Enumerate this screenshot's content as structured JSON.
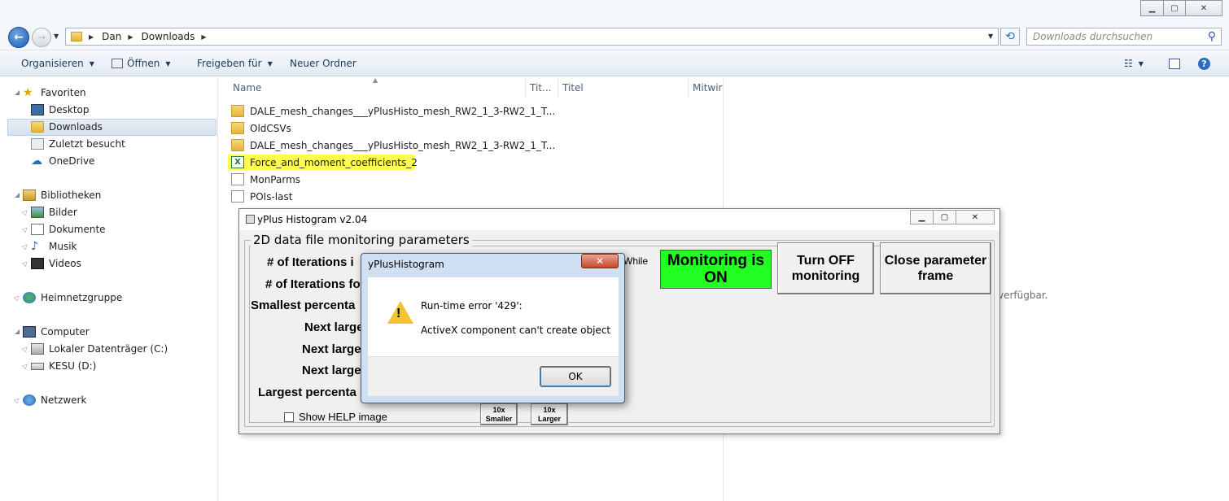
{
  "explorer": {
    "address": {
      "seg1": "Dan",
      "seg2": "Downloads"
    },
    "search_placeholder": "Downloads durchsuchen",
    "toolbar": {
      "organize": "Organisieren",
      "open": "Öffnen",
      "share": "Freigeben für",
      "new_folder": "Neuer Ordner"
    },
    "nav": {
      "favorites": "Favoriten",
      "desktop": "Desktop",
      "downloads": "Downloads",
      "recent": "Zuletzt besucht",
      "onedrive": "OneDrive",
      "libraries": "Bibliotheken",
      "pictures": "Bilder",
      "documents": "Dokumente",
      "music": "Musik",
      "videos": "Videos",
      "homegroup": "Heimnetzgruppe",
      "computer": "Computer",
      "local_disk": "Lokaler Datenträger (C:)",
      "kesu": "KESU (D:)",
      "network": "Netzwerk"
    },
    "columns": {
      "name": "Name",
      "tit": "Tit...",
      "title": "Titel",
      "contrib": "Mitwirk"
    },
    "files": [
      {
        "name": "DALE_mesh_changes___yPlusHisto_mesh_RW2_1_3-RW2_1_T..."
      },
      {
        "name": "OldCSVs"
      },
      {
        "name": "DALE_mesh_changes___yPlusHisto_mesh_RW2_1_3-RW2_1_T..."
      },
      {
        "name": "Force_and_moment_coefficients_2"
      },
      {
        "name": "MonParms"
      },
      {
        "name": "POIs-last"
      }
    ],
    "preview_text": "verfügbar."
  },
  "yplus": {
    "title": "yPlus Histogram v2.04",
    "frame_label": "2D data file monitoring parameters",
    "labels": [
      "# of Iterations i",
      "# of Iterations fo",
      "Smallest percenta",
      "Next large",
      "Next large",
      "Next large",
      "Largest percenta"
    ],
    "while_text": "While",
    "monitoring_status": "Monitoring is ON",
    "turn_off_button": "Turn OFF monitoring",
    "close_frame_button": "Close parameter frame",
    "show_help_label": "Show HELP image",
    "smaller_button": "10x Smaller",
    "larger_button": "10x Larger"
  },
  "dialog": {
    "title": "yPlusHistogram",
    "message1": "Run-time error '429':",
    "message2": "ActiveX component can't create object",
    "ok_button": "OK",
    "close_glyph": "✕"
  },
  "colors": {
    "monitoring_on": "#22ff22",
    "highlight": "#ffff33",
    "accent": "#1c5bb0"
  }
}
